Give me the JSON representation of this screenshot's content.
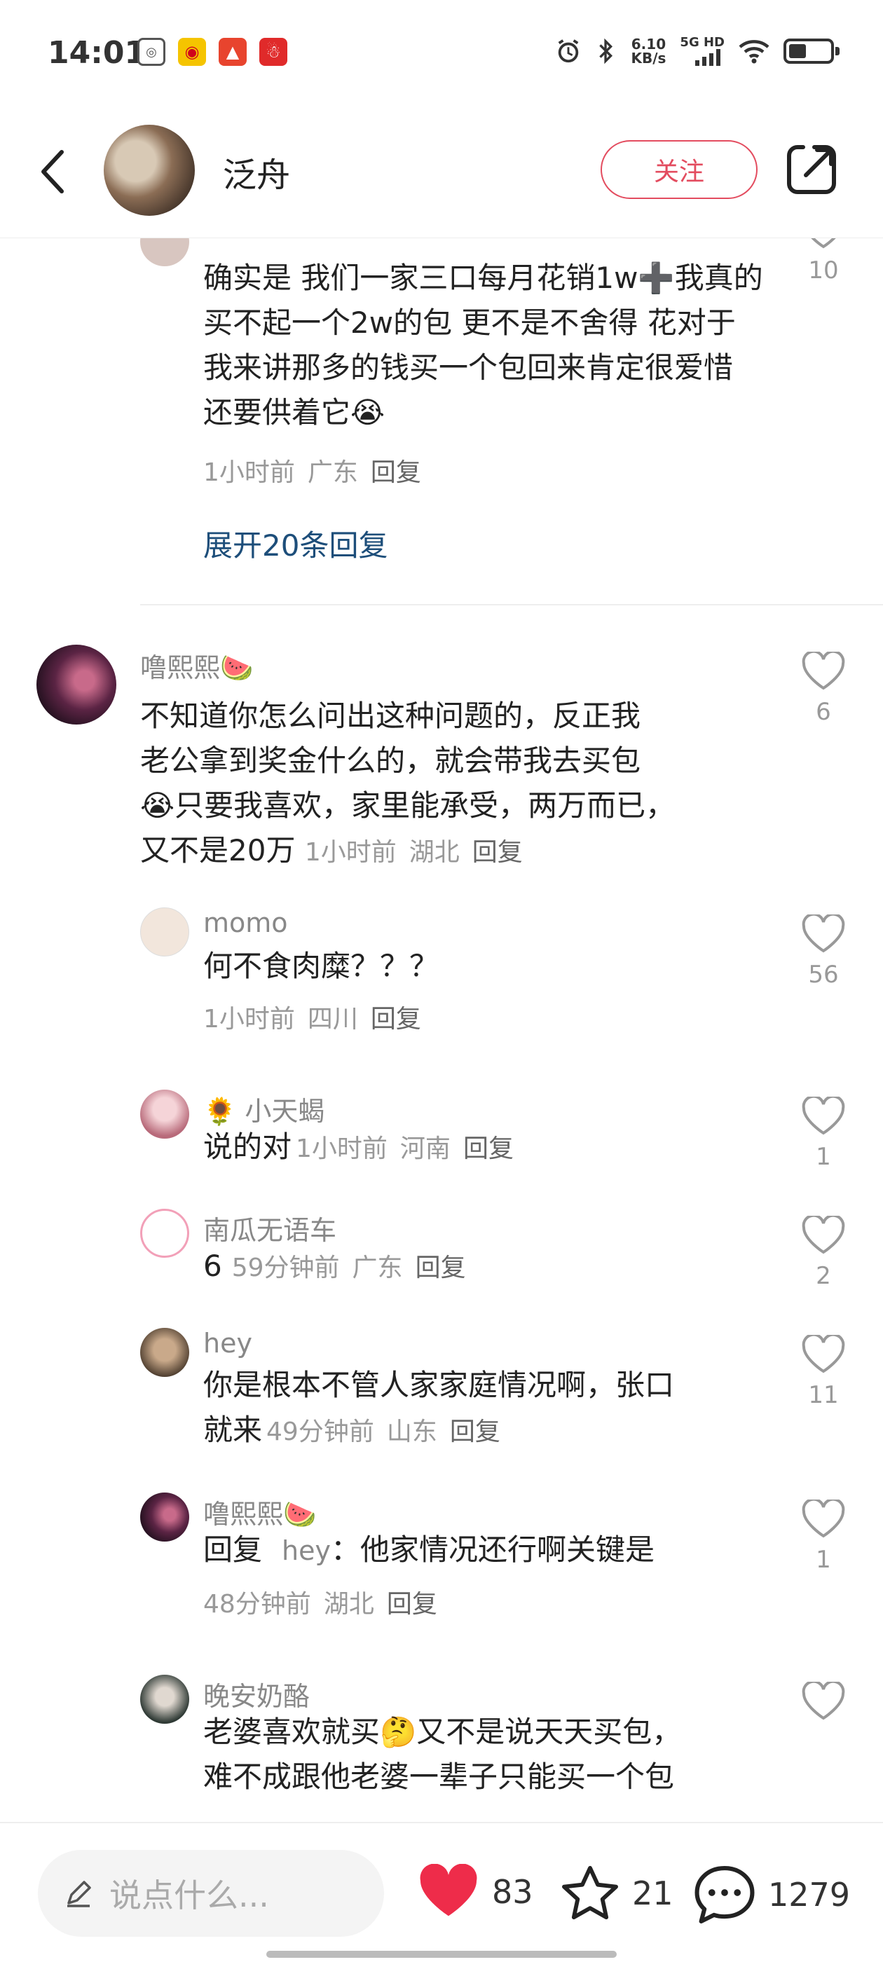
{
  "status_bar": {
    "time": "14:01",
    "net_speed_value": "6.10",
    "net_speed_unit": "KB/s",
    "signal": "5G HD"
  },
  "header": {
    "author": "泛舟",
    "follow_label": "关注"
  },
  "thread": {
    "top_comment": {
      "text": "确实是 我们一家三口每月花销1w➕我真的买不起一个2w的包 更不是不舍得 花对于我来讲那多的钱买一个包回来肯定很爱惜 还要供着它",
      "emoji": "😭",
      "time": "1小时前",
      "region": "广东",
      "reply": "回复",
      "likes": "10",
      "expand_label": "展开20条回复"
    },
    "comment2": {
      "name": "噜熙熙🍉",
      "text_line1": "不知道你怎么问出这种问题的，反正我",
      "text_line2": "老公拿到奖金什么的，就会带我去买包",
      "text_line3": "😭只要我喜欢，家里能承受，两万而已，",
      "text_line4": "又不是20万",
      "time": "1小时前",
      "region": "湖北",
      "reply": "回复",
      "likes": "6"
    },
    "replies": [
      {
        "name": "momo",
        "text": "何不食肉糜？？？",
        "time": "1小时前",
        "region": "四川",
        "reply": "回复",
        "likes": "56"
      },
      {
        "name": "🌻 小天蝎",
        "text": "说的对",
        "time": "1小时前",
        "region": "河南",
        "reply": "回复",
        "likes": "1"
      },
      {
        "name": "南瓜无语车",
        "text": "6",
        "time": "59分钟前",
        "region": "广东",
        "reply": "回复",
        "likes": "2"
      },
      {
        "name": "hey",
        "text_line1": "你是根本不管人家家庭情况啊，张口",
        "text_line2": "就来",
        "time": "49分钟前",
        "region": "山东",
        "reply": "回复",
        "likes": "11"
      },
      {
        "name": "噜熙熙🍉",
        "reply_prefix": "回复",
        "reply_to": "hey",
        "text": "：他家情况还行啊关键是",
        "time": "48分钟前",
        "region": "湖北",
        "reply": "回复",
        "likes": "1"
      },
      {
        "name": "晚安奶酪",
        "text_line1": "老婆喜欢就买🤔又不是说天天买包，",
        "text_line2": "难不成跟他老婆一辈子只能买一个包",
        "likes": ""
      }
    ]
  },
  "bottom_bar": {
    "placeholder": "说点什么...",
    "likes": "83",
    "favorites": "21",
    "comments": "1279"
  },
  "colors": {
    "accent": "#e34c5f",
    "link": "#1d4e7a",
    "heart": "#ee2c4a"
  }
}
